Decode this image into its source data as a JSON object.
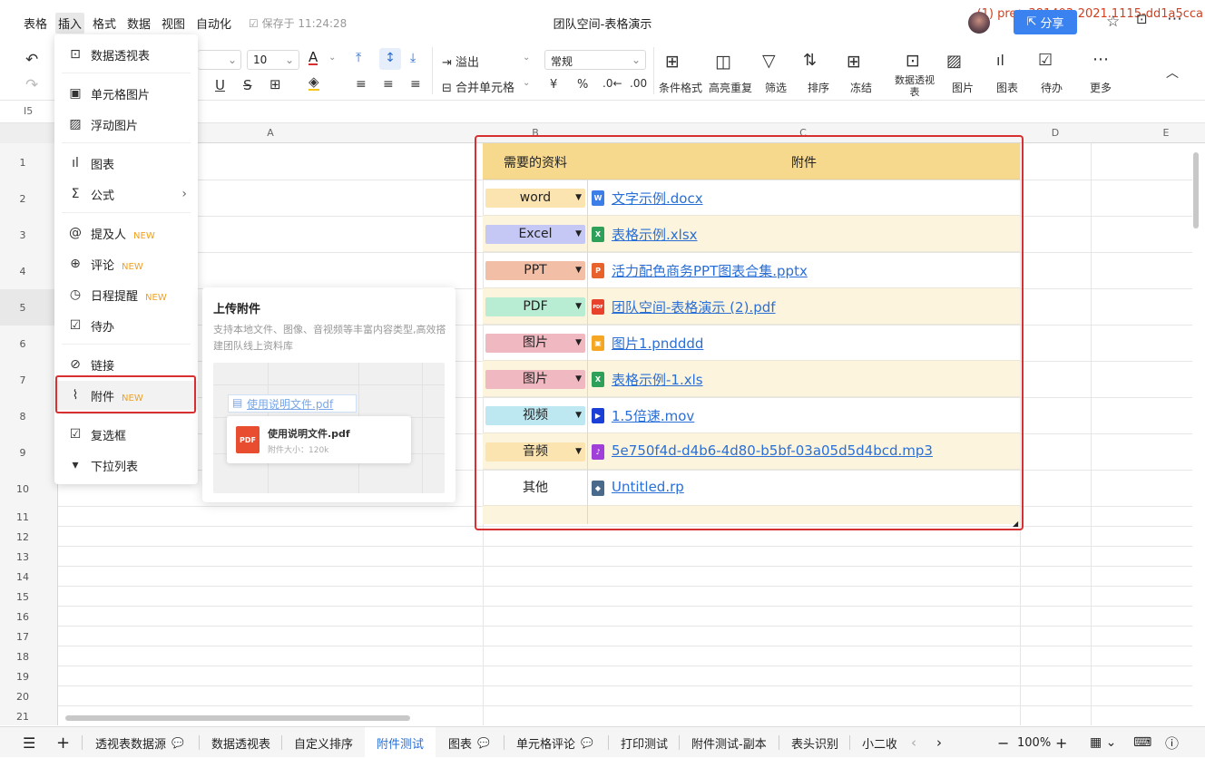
{
  "topbar": {
    "menus": [
      "表格",
      "插入",
      "格式",
      "数据",
      "视图",
      "自动化"
    ],
    "saved": "保存于 11:24:28",
    "title": "团队空间-表格演示",
    "pre_tag": "(1) pre：381403-2021.1115-dd1a5cca",
    "share": "分享"
  },
  "toolbar": {
    "font_size": "10",
    "overflow": "溢出",
    "merge": "合并单元格",
    "number_format": "常规",
    "currency": "¥",
    "percent": "%",
    "buttons": [
      "条件格式",
      "高亮重复",
      "筛选",
      "排序",
      "冻结",
      "数据透视表",
      "图片",
      "图表",
      "待办",
      "更多"
    ]
  },
  "formula_bar": {
    "cell_ref": "I5"
  },
  "columns": [
    "A",
    "B",
    "C",
    "D",
    "E"
  ],
  "rows": [
    "1",
    "2",
    "3",
    "4",
    "5",
    "6",
    "7",
    "8",
    "9",
    "10",
    "11",
    "12",
    "13",
    "14",
    "15",
    "16",
    "17",
    "18",
    "19",
    "20",
    "21"
  ],
  "insert_menu": {
    "items": [
      {
        "label": "数据透视表",
        "icon": "pivot-table-icon"
      },
      {
        "label": "单元格图片",
        "icon": "cell-image-icon"
      },
      {
        "label": "浮动图片",
        "icon": "float-image-icon"
      },
      {
        "label": "图表",
        "icon": "chart-icon"
      },
      {
        "label": "公式",
        "icon": "sigma-icon"
      },
      {
        "label": "提及人",
        "icon": "at-icon",
        "badge": "NEW"
      },
      {
        "label": "评论",
        "icon": "comment-icon",
        "badge": "NEW"
      },
      {
        "label": "日程提醒",
        "icon": "alarm-icon",
        "badge": "NEW"
      },
      {
        "label": "待办",
        "icon": "todo-icon"
      },
      {
        "label": "链接",
        "icon": "link-icon"
      },
      {
        "label": "附件",
        "icon": "paperclip-icon",
        "badge": "NEW"
      },
      {
        "label": "复选框",
        "icon": "checkbox-icon"
      },
      {
        "label": "下拉列表",
        "icon": "dropdown-icon"
      }
    ]
  },
  "attach_popup": {
    "title": "上传附件",
    "desc": "支持本地文件、图像、音视频等丰富内容类型,高效搭建团队线上资料库",
    "file_link": "使用说明文件.pdf",
    "card_name": "使用说明文件.pdf",
    "card_size": "附件大小：120k",
    "pdf_label": "PDF"
  },
  "table": {
    "header": [
      "需要的资料",
      "附件"
    ],
    "rows": [
      {
        "type": "word",
        "color": "#fbe4b0",
        "file": "文字示例.docx",
        "icon_color": "#3b7ee8",
        "icon_text": "W"
      },
      {
        "type": "Excel",
        "color": "#c5c8f4",
        "file": "表格示例.xlsx",
        "icon_color": "#2ea05a",
        "icon_text": "X"
      },
      {
        "type": "PPT",
        "color": "#f2bfa6",
        "file": "活力配色商务PPT图表合集.pptx",
        "icon_color": "#e8622c",
        "icon_text": "P"
      },
      {
        "type": "PDF",
        "color": "#b8ecd3",
        "file": "团队空间-表格演示 (2).pdf",
        "icon_color": "#e8422c",
        "icon_text": "PDF"
      },
      {
        "type": "图片",
        "color": "#f0b8c0",
        "file": "图片1.pndddd",
        "icon_color": "#f5a623",
        "icon_text": "▣"
      },
      {
        "type": "图片",
        "color": "#f0b8c0",
        "file": "表格示例-1.xls",
        "icon_color": "#2ea05a",
        "icon_text": "X"
      },
      {
        "type": "视频",
        "color": "#bde8f2",
        "file": "1.5倍速.mov",
        "icon_color": "#1a3fd6",
        "icon_text": "▶"
      },
      {
        "type": "音频",
        "color": "#fbe4b0",
        "file": "5e750f4d-d4b6-4d80-b5bf-03a05d5d4bcd.mp3",
        "icon_color": "#a040d8",
        "icon_text": "♪"
      },
      {
        "type": "其他",
        "color": "",
        "file": "Untitled.rp",
        "icon_color": "#4a6a8c",
        "icon_text": "◆"
      }
    ]
  },
  "sheet_tabs": [
    "透视表数据源",
    "数据透视表",
    "自定义排序",
    "附件测试",
    "图表",
    "单元格评论",
    "打印测试",
    "附件测试-副本",
    "表头识别",
    "小二收"
  ],
  "zoom": "100%"
}
